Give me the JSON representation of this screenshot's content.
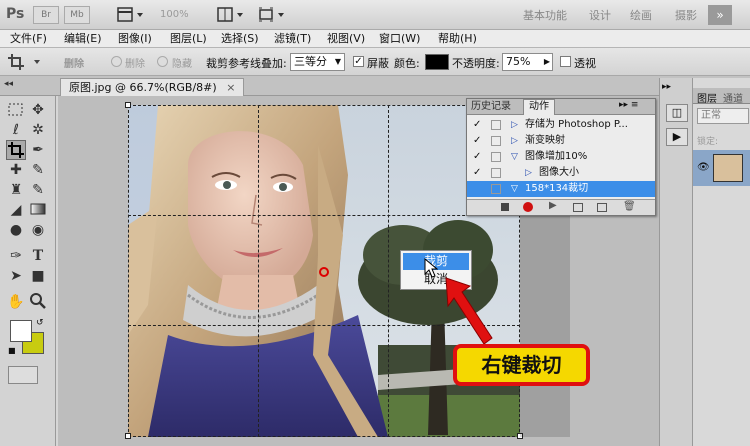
{
  "app": {
    "logo": "Ps",
    "top_buttons": [
      "Br",
      "Mb"
    ],
    "zoom": "100%",
    "workspaces": [
      "基本功能",
      "设计",
      "绘画",
      "摄影"
    ]
  },
  "menu": [
    "文件(F)",
    "编辑(E)",
    "图像(I)",
    "图层(L)",
    "选择(S)",
    "滤镜(T)",
    "视图(V)",
    "窗口(W)",
    "帮助(H)"
  ],
  "options": {
    "shield_label": "删除",
    "hide_label": "隐藏",
    "overlay_label": "裁剪参考线叠加:",
    "overlay_value": "三等分",
    "shield_cb_label": "屏蔽",
    "color_label": "颜色:",
    "opacity_label": "不透明度:",
    "opacity_value": "75%",
    "perspective_label": "透视"
  },
  "document": {
    "tab_title": "原图.jpg @ 66.7%(RGB/8#)"
  },
  "panels": {
    "history_tab": "历史记录",
    "actions_tab": "动作",
    "actions": [
      {
        "label": "存储为 Photoshop P...",
        "checked": true,
        "selected": false
      },
      {
        "label": "渐变映射",
        "checked": true,
        "selected": false
      },
      {
        "label": "图像增加10%",
        "checked": true,
        "selected": false
      },
      {
        "label": "图像大小",
        "checked": true,
        "selected": false
      },
      {
        "label": "158*134裁切",
        "checked": false,
        "selected": true
      }
    ],
    "layers_tab": "图层",
    "channels_tab": "通道",
    "blend_mode": "正常",
    "lock_label": "锁定:"
  },
  "context_menu": {
    "items": [
      "裁剪",
      "取消"
    ]
  },
  "callout": "右键裁切",
  "colors": {
    "accent": "#3c8ee8",
    "callout_bg": "#f5d800",
    "callout_border": "#e01010",
    "foreground": "#ffffff",
    "background": "#c8cc10"
  }
}
